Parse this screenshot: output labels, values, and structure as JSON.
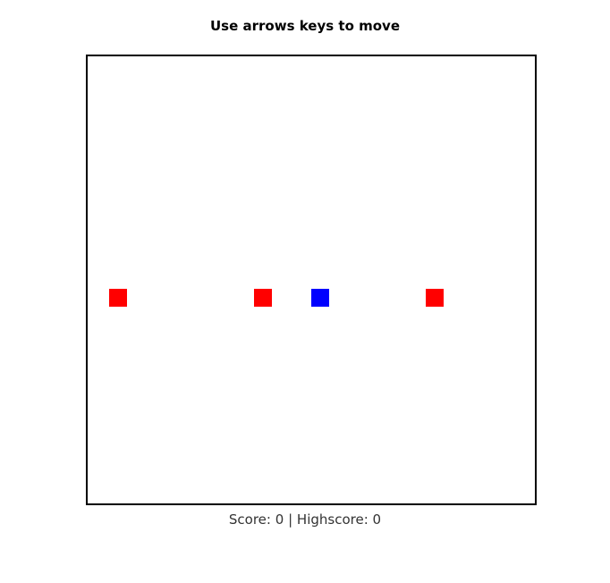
{
  "header": {
    "instructions": "Use arrows keys to move"
  },
  "status": {
    "score_label": "Score:",
    "score": "0",
    "separator": "|",
    "highscore_label": "Highscore:",
    "highscore": "0"
  },
  "colors": {
    "player": "#0000ff",
    "enemy": "#ff0000",
    "border": "#000000"
  },
  "game": {
    "player": {
      "col": 12.5,
      "row": 13
    },
    "enemies": [
      {
        "col": 1.2,
        "row": 13
      },
      {
        "col": 9.3,
        "row": 13
      },
      {
        "col": 18.9,
        "row": 13
      }
    ]
  }
}
